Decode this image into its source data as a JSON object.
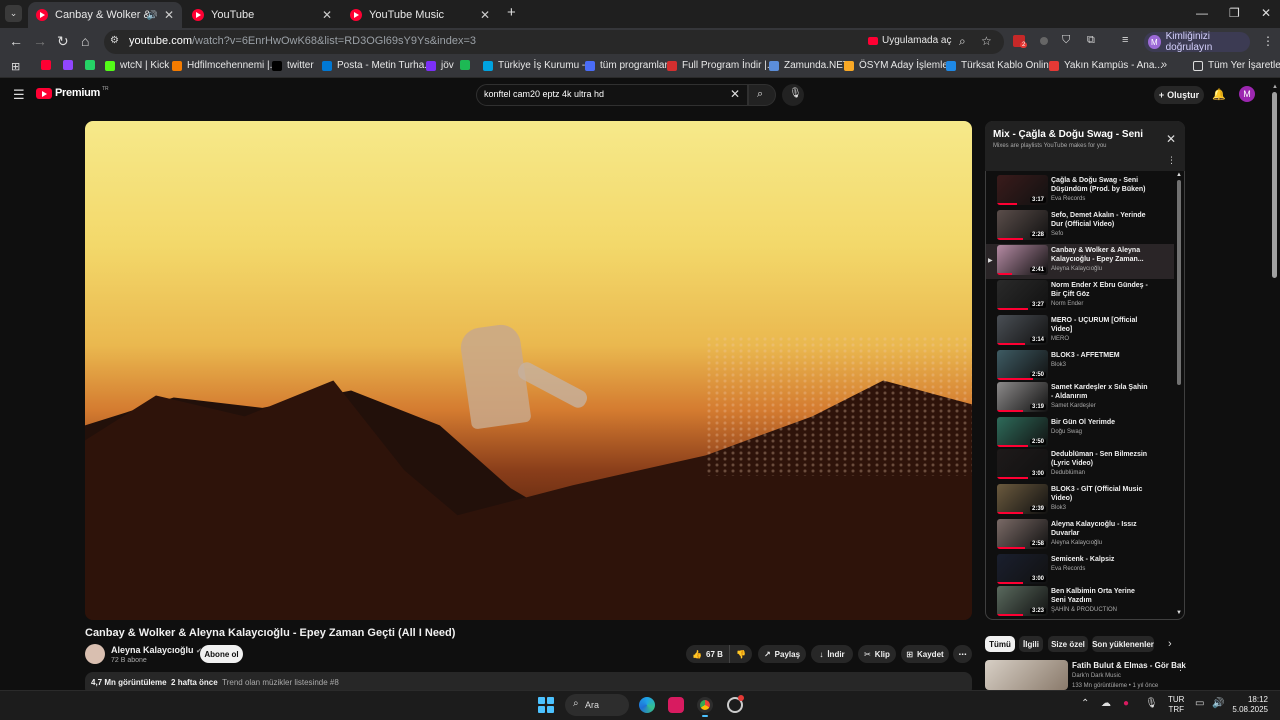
{
  "browser": {
    "tabs": [
      {
        "title": "Canbay & Wolker & Aleyna",
        "active": true
      },
      {
        "title": "YouTube",
        "active": false
      },
      {
        "title": "YouTube Music",
        "active": false
      }
    ],
    "new_tab": "+",
    "url_host": "youtube.com",
    "url_path": "/watch?v=6EnrHwOwK68&list=RD3OGl69sY9Ys&index=3",
    "open_in_app": "Uygulamada aç",
    "profile_chip": "Kimliğinizi doğrulayın",
    "profile_initial": "M",
    "extension_badge": "2"
  },
  "bookmarks": [
    {
      "label": "",
      "color": "#ff0033"
    },
    {
      "label": "",
      "color": "#9146ff"
    },
    {
      "label": "",
      "color": "#25d366"
    },
    {
      "label": "wtcN | Kick",
      "color": "#53fc18"
    },
    {
      "label": "Hdfilmcehennemi |...",
      "color": "#f57c00"
    },
    {
      "label": "twitter",
      "color": "#000000"
    },
    {
      "label": "Posta - Metin Turha...",
      "color": "#0078d4"
    },
    {
      "label": "jöv",
      "color": "#7b2ff7"
    },
    {
      "label": "",
      "color": "#1db954"
    },
    {
      "label": "Türkiye İş Kurumu -...",
      "color": "#00a3e0"
    },
    {
      "label": "tüm programlar",
      "color": "#4a6cf7"
    },
    {
      "label": "Full Program İndir |...",
      "color": "#d32f2f"
    },
    {
      "label": "Zamunda.NET",
      "color": "#5b8dd9"
    },
    {
      "label": "ÖSYM Aday İşlemle...",
      "color": "#f9a825"
    },
    {
      "label": "Türksat Kablo Onlin...",
      "color": "#1e88e5"
    },
    {
      "label": "Yakın Kampüs - Ana...",
      "color": "#e53935"
    }
  ],
  "bookmarks_all": "Tüm Yer İşaretleri",
  "youtube": {
    "logo": "Premium",
    "logo_region": "TR",
    "search_value": "konftel cam20 eptz 4k ultra hd",
    "create_label": "Oluştur",
    "avatar_initial": "M"
  },
  "video": {
    "title": "Canbay & Wolker & Aleyna Kalaycıoğlu - Epey Zaman Geçti (All I Need)",
    "channel": "Aleyna Kalaycıoğlu",
    "subscribers": "72 B abone",
    "subscribe_label": "Abone ol",
    "likes": "67 B",
    "share": "Paylaş",
    "download": "İndir",
    "clip": "Klip",
    "save": "Kaydet",
    "more": "⋯",
    "views": "4,7 Mn görüntüleme",
    "age": "2 hafta önce",
    "trend": "Trend olan müzikler listesinde #8"
  },
  "playlist": {
    "title": "Mix - Çağla & Doğu Swag - Seni...",
    "subtitle": "Mixes are playlists YouTube makes for you",
    "items": [
      {
        "title": "Çağla & Doğu Swag - Seni Düşündüm (Prod. by Büken)",
        "channel": "Eva Records",
        "duration": "3:17",
        "thumb": "#3a1b1b",
        "progress": 0.4
      },
      {
        "title": "Sefo, Demet Akalın - Yerinde Dur (Official Video)",
        "channel": "Sefo",
        "duration": "2:28",
        "thumb": "#5a4d4a",
        "progress": 0.5
      },
      {
        "title": "Canbay & Wolker & Aleyna Kalaycıoğlu - Epey Zaman...",
        "channel": "Aleyna Kalaycıoğlu",
        "duration": "2:41",
        "thumb": "#b58aa3",
        "progress": 0.3
      },
      {
        "title": "Norm Ender X Ebru Gündeş - Bir Çift Göz",
        "channel": "Norm Ender",
        "duration": "3:27",
        "thumb": "#2a2a2a",
        "progress": 0.6
      },
      {
        "title": "MERO - UÇURUM [Official Video]",
        "channel": "MERO",
        "duration": "3:14",
        "thumb": "#4a4f55",
        "progress": 0.55
      },
      {
        "title": "BLOK3 - AFFETMEM",
        "channel": "Blok3",
        "duration": "2:50",
        "thumb": "#3e5b63",
        "progress": 0.7
      },
      {
        "title": "Samet Kardeşler x Sıla Şahin - Aldanırım",
        "channel": "Samet Kardeşler",
        "duration": "3:19",
        "thumb": "#8c8a8a",
        "progress": 0.5
      },
      {
        "title": "Bir Gün Ol Yerimde",
        "channel": "Doğu Swag",
        "duration": "2:50",
        "thumb": "#2e6b5a",
        "progress": 0.6
      },
      {
        "title": "Dedublüman - Sen Bilmezsin (Lyric Video)",
        "channel": "Dedublüman",
        "duration": "3:00",
        "thumb": "#1e1a1a",
        "progress": 0.6
      },
      {
        "title": "BLOK3 - GİT (Official Music Video)",
        "channel": "Blok3",
        "duration": "2:39",
        "thumb": "#6b5a3e",
        "progress": 0.5
      },
      {
        "title": "Aleyna Kalaycıoğlu - Issız Duvarlar",
        "channel": "Aleyna Kalaycıoğlu",
        "duration": "2:58",
        "thumb": "#7a6a66",
        "progress": 0.55
      },
      {
        "title": "Semicenk - Kalpsiz",
        "channel": "Eva Records",
        "duration": "3:00",
        "thumb": "#1a1f2e",
        "progress": 0.5
      },
      {
        "title": "Ben Kalbimin Orta Yerine Seni Yazdım",
        "channel": "ŞAHİN & PRODUCTION",
        "duration": "3:23",
        "thumb": "#5a6a5e",
        "progress": 0.5
      }
    ]
  },
  "chips": [
    {
      "label": "Tümü",
      "selected": true
    },
    {
      "label": "İlgili",
      "selected": false
    },
    {
      "label": "Size özel",
      "selected": false
    },
    {
      "label": "Son yüklenenler",
      "selected": false
    }
  ],
  "recommendation": {
    "title": "Fatih Bulut & Elmas - Gör Bak",
    "channel": "Dark'n Dark Music",
    "meta": "133 Mn görüntüleme • 1 yıl önce"
  },
  "taskbar": {
    "search": "Ara",
    "lang_top": "TUR",
    "lang_bottom": "TRF",
    "time": "18:12",
    "date": "5.08.2025"
  }
}
